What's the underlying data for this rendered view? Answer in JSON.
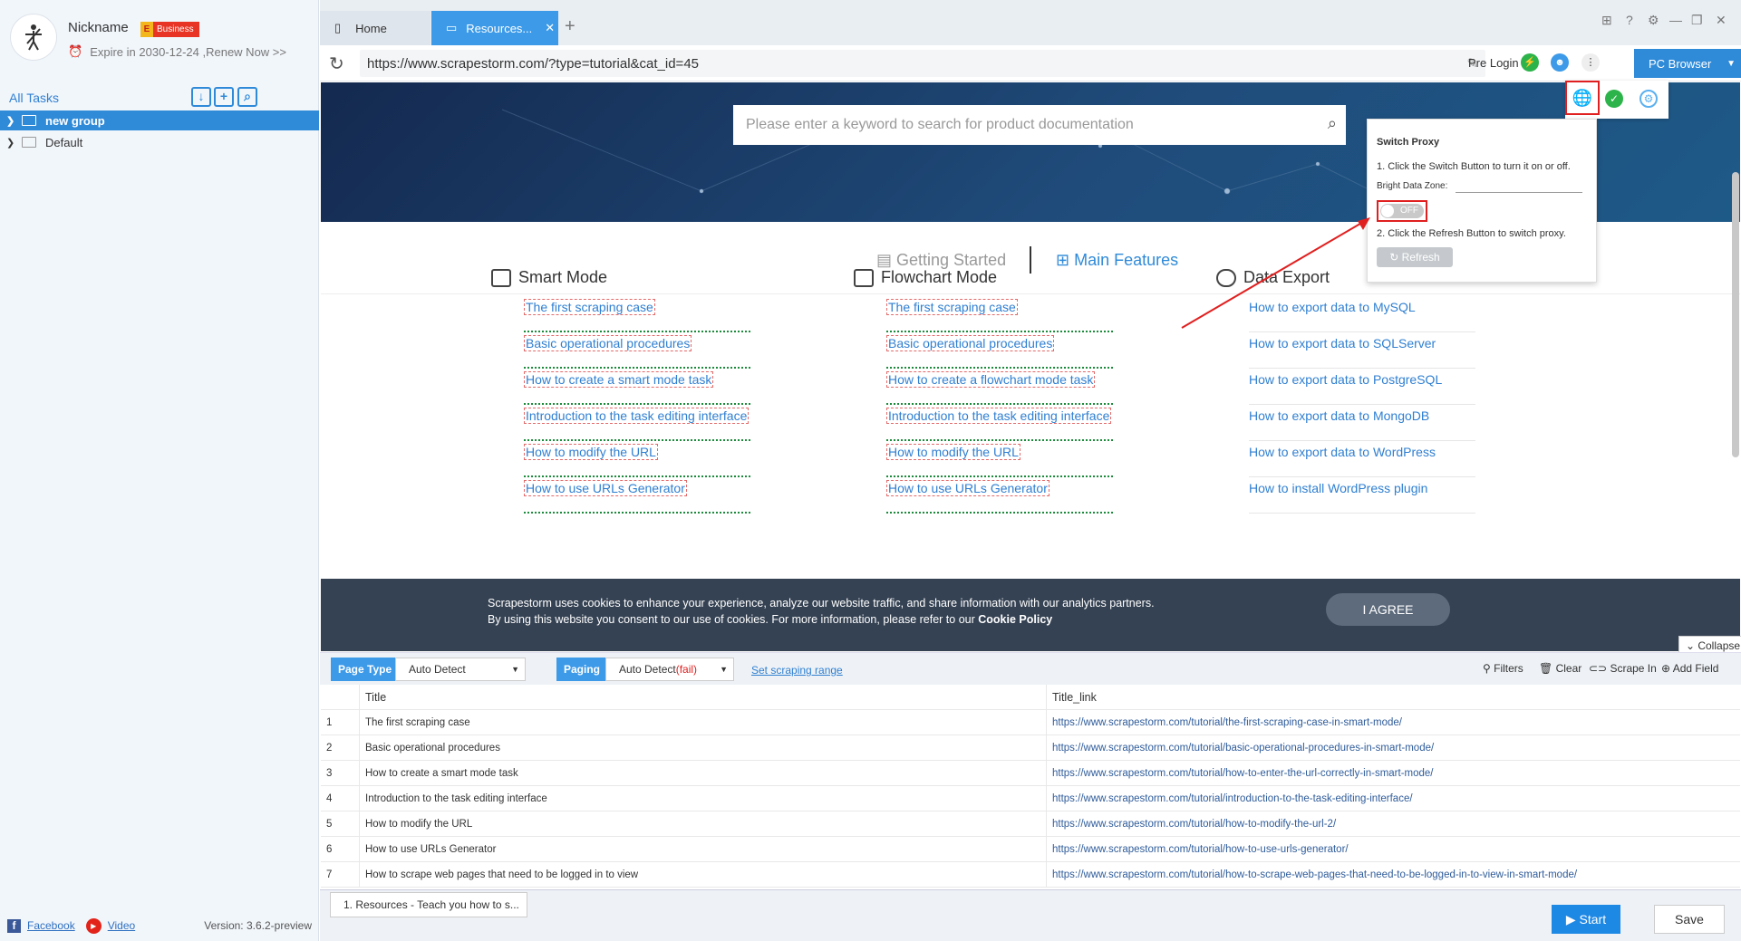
{
  "profile": {
    "nickname": "Nickname",
    "badge_letter": "E",
    "badge": "Business",
    "expire": "Expire in 2030-12-24 ,Renew Now >>"
  },
  "sidebar": {
    "all_tasks": "All Tasks",
    "items": [
      {
        "label": "new group"
      },
      {
        "label": "Default"
      }
    ],
    "footer": {
      "facebook": "Facebook",
      "video": "Video",
      "version": "Version: 3.6.2-preview"
    }
  },
  "tabs": [
    {
      "label": "Home"
    },
    {
      "label": "Resources..."
    }
  ],
  "address": {
    "url": "https://www.scrapestorm.com/?type=tutorial&cat_id=45",
    "pre_login": "Pre Login",
    "pc_browser": "PC Browser"
  },
  "hero": {
    "search_placeholder": "Please enter a keyword to search for product documentation"
  },
  "doc_tabs": {
    "getting_started": "Getting Started",
    "main_features": "Main Features"
  },
  "columns": [
    {
      "title": "Smart Mode",
      "links": [
        "The first scraping case",
        "Basic operational procedures",
        "How to create a smart mode task",
        "Introduction to the task editing interface",
        "How to modify the URL",
        "How to use URLs Generator"
      ]
    },
    {
      "title": "Flowchart Mode",
      "links": [
        "The first scraping case",
        "Basic operational procedures",
        "How to create a flowchart mode task",
        "Introduction to the task editing interface",
        "How to modify the URL",
        "How to use URLs Generator"
      ]
    },
    {
      "title": "Data Export",
      "links": [
        "How to export data to MySQL",
        "How to export data to SQLServer",
        "How to export data to PostgreSQL",
        "How to export data to MongoDB",
        "How to export data to WordPress",
        "How to install WordPress plugin"
      ]
    }
  ],
  "cookie": {
    "line1": "Scrapestorm uses cookies to enhance your experience, analyze our website traffic, and share information with our analytics partners.",
    "line2": "By using this website you consent to our use of cookies. For more information, please refer to our ",
    "policy": "Cookie Policy",
    "agree": "I AGREE"
  },
  "proxy": {
    "title": "Switch Proxy",
    "step1": "1. Click the Switch Button to turn it on or off.",
    "zone_label": "Bright Data Zone:",
    "switch": "OFF",
    "step2": "2. Click the Refresh Button to switch proxy.",
    "refresh": "Refresh"
  },
  "collapse": "Collapse",
  "toolbar": {
    "page_type": "Page Type",
    "page_type_value": "Auto Detect",
    "paging": "Paging",
    "paging_value": "Auto Detect",
    "paging_fail": "(fail)",
    "set_range": "Set scraping range",
    "filters": "Filters",
    "clear": "Clear",
    "scrape_in": "Scrape In",
    "add_field": "Add Field"
  },
  "grid": {
    "headers": [
      "Title",
      "Title_link"
    ],
    "rows": [
      [
        "1",
        "The first scraping case",
        "https://www.scrapestorm.com/tutorial/the-first-scraping-case-in-smart-mode/"
      ],
      [
        "2",
        "Basic operational procedures",
        "https://www.scrapestorm.com/tutorial/basic-operational-procedures-in-smart-mode/"
      ],
      [
        "3",
        "How to create a smart mode task",
        "https://www.scrapestorm.com/tutorial/how-to-enter-the-url-correctly-in-smart-mode/"
      ],
      [
        "4",
        "Introduction to the task editing interface",
        "https://www.scrapestorm.com/tutorial/introduction-to-the-task-editing-interface/"
      ],
      [
        "5",
        "How to modify the URL",
        "https://www.scrapestorm.com/tutorial/how-to-modify-the-url-2/"
      ],
      [
        "6",
        "How to use URLs Generator",
        "https://www.scrapestorm.com/tutorial/how-to-use-urls-generator/"
      ],
      [
        "7",
        "How to scrape web pages that need to be logged in to view",
        "https://www.scrapestorm.com/tutorial/how-to-scrape-web-pages-that-need-to-be-logged-in-to-view-in-smart-mode/"
      ]
    ]
  },
  "footer": {
    "page_tab": "1. Resources - Teach you how to s...",
    "start": "Start",
    "save": "Save"
  }
}
